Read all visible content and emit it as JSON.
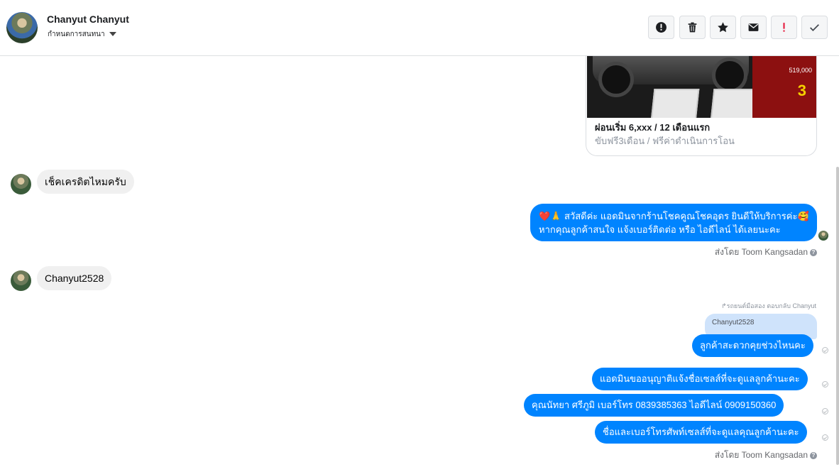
{
  "header": {
    "contact_name": "Chanyut Chanyut",
    "contact_sub": "กำหนดการสนทนา",
    "actions": [
      {
        "name": "report-button",
        "icon": "alert-circle-icon"
      },
      {
        "name": "delete-button",
        "icon": "trash-icon"
      },
      {
        "name": "star-button",
        "icon": "star-icon"
      },
      {
        "name": "mail-button",
        "icon": "envelope-icon"
      },
      {
        "name": "mark-important-button",
        "icon": "exclamation-icon"
      },
      {
        "name": "mark-done-button",
        "icon": "check-icon"
      }
    ]
  },
  "card": {
    "image_price": "519,000",
    "image_big": "3",
    "title": "ผ่อนเริ่ม 6,xxx / 12 เดือนแรก",
    "subtitle": "ขับฟรี3เดือน / ฟรีค่าดำเนินการโอน"
  },
  "messages": {
    "in_1": "เช็คเครดิตไหมครับ",
    "out_1_line1": "❤️🙏 สวัสดีค่ะ แอดมินจากร้านโชคคูณโชคอุดร ยินดีให้บริการค่ะ🥰",
    "out_1_line2": "หากคุณลูกค้าสนใจ แจ้งเบอร์ติดต่อ หรือ ไอดีไลน์ ได้เลยนะคะ",
    "sent_by_1": "ส่งโดย Toom Kangsadan",
    "in_2": "Chanyut2528",
    "reply_label": "รถยนต์มือสอง ตอบกลับ Chanyut",
    "reply_quote": "Chanyut2528",
    "out_2": "ลูกค้าสะดวกคุยช่วงไหนคะ",
    "out_3": "แอดมินขออนุญาติแจ้งชื่อเซลส์ที่จะดูแลลูกค้านะคะ",
    "out_4": "คุณนัทยา ศรีภูมิ      เบอร์โทร 0839385363  ไอดีไลน์ 0909150360",
    "out_5": "ชื่อและเบอร์โทรศัพท์เซลส์ที่จะดูแลคุณลูกค้านะคะ",
    "sent_by_2": "ส่งโดย Toom Kangsadan"
  },
  "colors": {
    "outgoing_bubble": "#0084ff",
    "incoming_bubble": "#f0f0f0",
    "reply_quote_bg": "#cfe3fb"
  }
}
